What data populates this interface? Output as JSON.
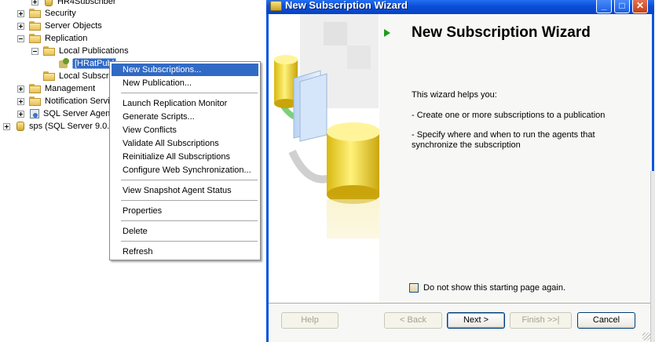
{
  "tree": {
    "items": [
      {
        "label": "HR4Subscriber",
        "expander": "plus",
        "icon": "server-icon"
      },
      {
        "label": "Security",
        "expander": "plus",
        "icon": "folder-icon"
      },
      {
        "label": "Server Objects",
        "expander": "plus",
        "icon": "folder-icon"
      },
      {
        "label": "Replication",
        "expander": "minus",
        "icon": "folder-icon"
      },
      {
        "label": "Local Publications",
        "expander": "minus",
        "icon": "folder-icon"
      },
      {
        "label": "[HRatPubl",
        "expander": "none",
        "icon": "publication-icon",
        "selected": true
      },
      {
        "label": "Local Subscri",
        "expander": "none",
        "icon": "folder-icon"
      },
      {
        "label": "Management",
        "expander": "plus",
        "icon": "folder-icon"
      },
      {
        "label": "Notification Servi",
        "expander": "plus",
        "icon": "folder-icon"
      },
      {
        "label": "SQL Server Agen",
        "expander": "plus",
        "icon": "agent-icon"
      },
      {
        "label": "sps (SQL Server 9.0.",
        "expander": "plus",
        "icon": "server-icon"
      }
    ]
  },
  "context_menu": {
    "items": [
      {
        "label": "New Subscriptions...",
        "highlighted": true
      },
      {
        "label": "New Publication..."
      },
      {
        "label": "Launch Replication Monitor"
      },
      {
        "label": "Generate Scripts..."
      },
      {
        "label": "View Conflicts"
      },
      {
        "label": "Validate All Subscriptions"
      },
      {
        "label": "Reinitialize All Subscriptions"
      },
      {
        "label": "Configure Web Synchronization..."
      },
      {
        "label": "View Snapshot Agent Status"
      },
      {
        "label": "Properties"
      },
      {
        "label": "Delete"
      },
      {
        "label": "Refresh"
      }
    ]
  },
  "wizard": {
    "window_title": "New Subscription Wizard",
    "heading": "New Subscription Wizard",
    "intro": "This wizard helps you:",
    "bullets": [
      "- Create one or more subscriptions to a publication",
      "- Specify where and when to run the agents that synchronize the subscription"
    ],
    "checkbox_label": "Do not show this starting page again.",
    "checkbox_checked": false,
    "buttons": {
      "help": "Help",
      "back": "< Back",
      "next": "Next >",
      "finish": "Finish >>|",
      "cancel": "Cancel"
    },
    "caption_buttons": {
      "minimize": "_",
      "maximize": "□",
      "close": "✕"
    }
  },
  "colors": {
    "selection": "#316ac5",
    "titlebar": "#0a4ed8",
    "accent_green": "#1f9a1f"
  }
}
